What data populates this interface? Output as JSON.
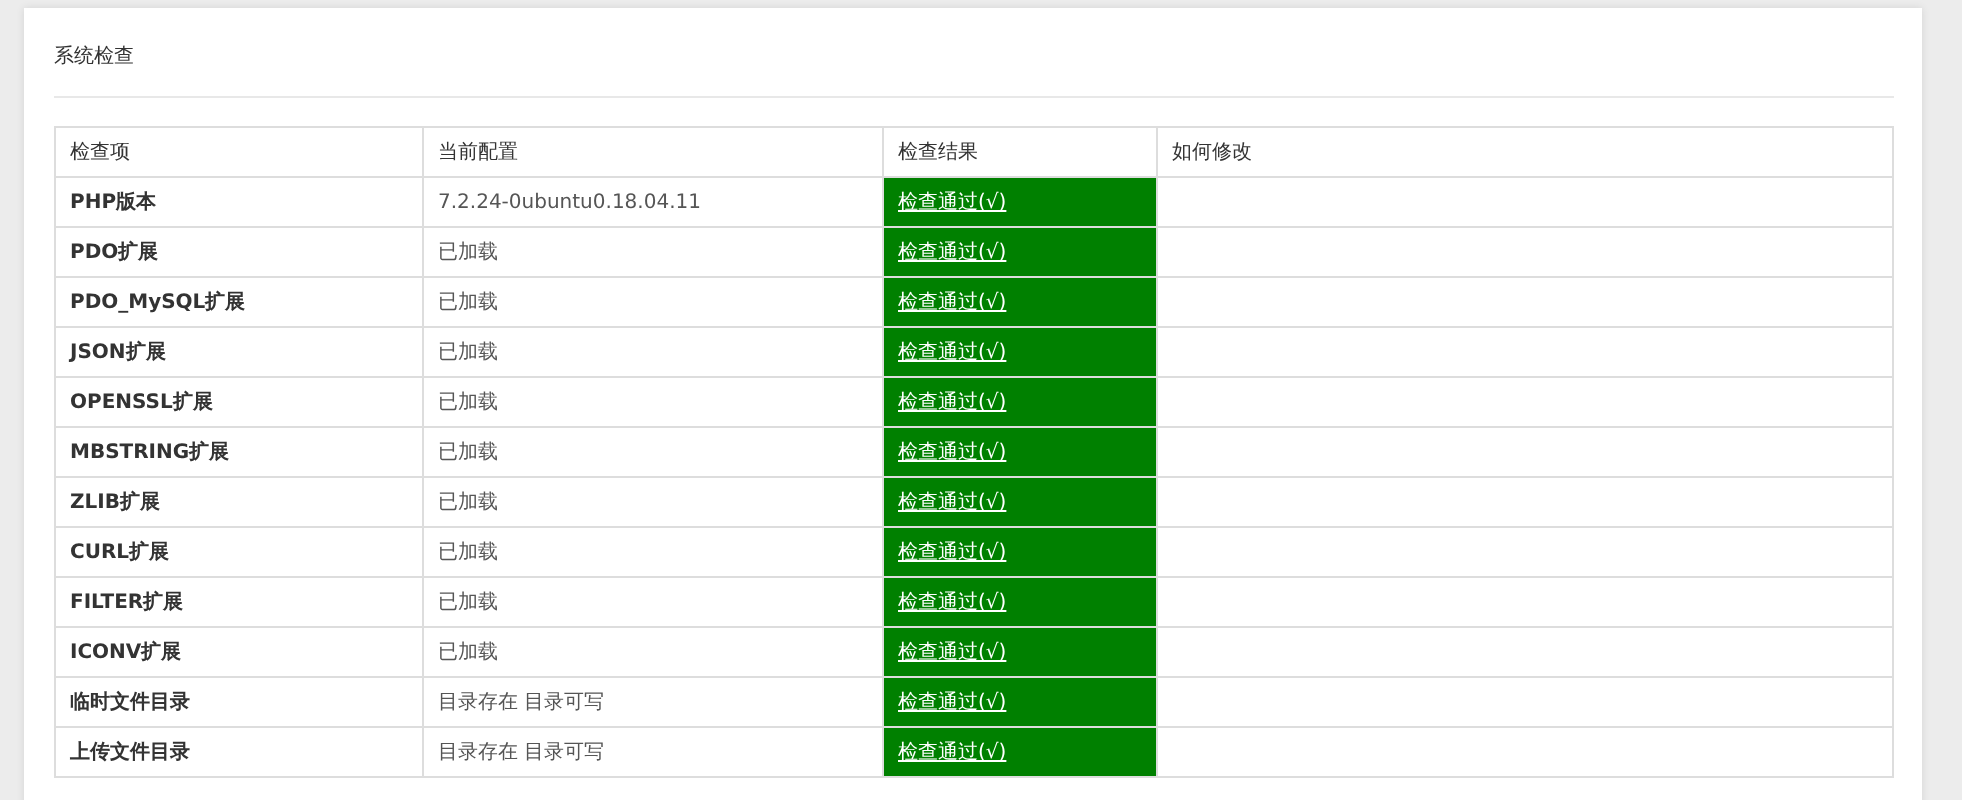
{
  "panel": {
    "title": "系统检查"
  },
  "table": {
    "columns": [
      "检查项",
      "当前配置",
      "检查结果",
      "如何修改"
    ],
    "rows": [
      {
        "item": "PHP版本",
        "config": "7.2.24-0ubuntu0.18.04.11",
        "result": "检查通过(√)",
        "passed": true
      },
      {
        "item": "PDO扩展",
        "config": "已加载",
        "result": "检查通过(√)",
        "passed": true
      },
      {
        "item": "PDO_MySQL扩展",
        "config": "已加载",
        "result": "检查通过(√)",
        "passed": true
      },
      {
        "item": "JSON扩展",
        "config": "已加载",
        "result": "检查通过(√)",
        "passed": true
      },
      {
        "item": "OPENSSL扩展",
        "config": "已加载",
        "result": "检查通过(√)",
        "passed": true
      },
      {
        "item": "MBSTRING扩展",
        "config": "已加载",
        "result": "检查通过(√)",
        "passed": true
      },
      {
        "item": "ZLIB扩展",
        "config": "已加载",
        "result": "检查通过(√)",
        "passed": true
      },
      {
        "item": "CURL扩展",
        "config": "已加载",
        "result": "检查通过(√)",
        "passed": true
      },
      {
        "item": "FILTER扩展",
        "config": "已加载",
        "result": "检查通过(√)",
        "passed": true
      },
      {
        "item": "ICONV扩展",
        "config": "已加载",
        "result": "检查通过(√)",
        "passed": true
      },
      {
        "item": "临时文件目录",
        "config": "目录存在 目录可写",
        "result": "检查通过(√)",
        "passed": true
      },
      {
        "item": "上传文件目录",
        "config": "目录存在 目录可写",
        "result": "检查通过(√)",
        "passed": true
      }
    ]
  }
}
